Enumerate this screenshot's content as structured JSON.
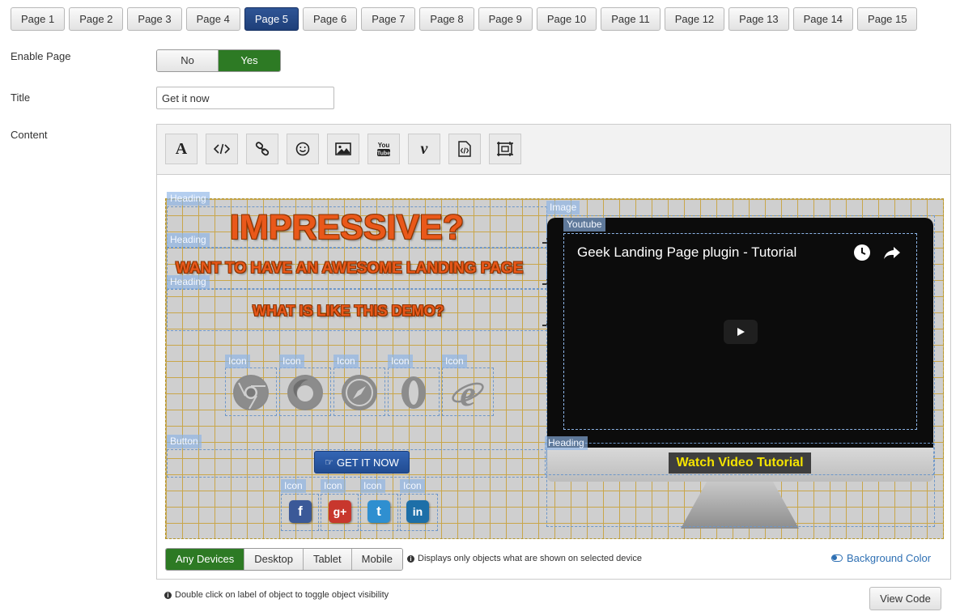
{
  "page_tabs": [
    "Page 1",
    "Page 2",
    "Page 3",
    "Page 4",
    "Page 5",
    "Page 6",
    "Page 7",
    "Page 8",
    "Page 9",
    "Page 10",
    "Page 11",
    "Page 12",
    "Page 13",
    "Page 14",
    "Page 15"
  ],
  "active_tab": "Page 5",
  "fields": {
    "enable_page_label": "Enable Page",
    "enable_no": "No",
    "enable_yes": "Yes",
    "title_label": "Title",
    "title_value": "Get it now",
    "content_label": "Content"
  },
  "toolbar_icons": [
    "text-icon",
    "code-icon",
    "link-icon",
    "smiley-icon",
    "image-icon",
    "youtube-icon",
    "vimeo-icon",
    "html-file-icon",
    "frame-icon"
  ],
  "canvas": {
    "labels": {
      "heading": "Heading",
      "image": "Image",
      "youtube": "Youtube",
      "icon": "Icon",
      "button": "Button"
    },
    "heading1": "IMPRESSIVE?",
    "heading2": "WANT TO HAVE AN AWESOME LANDING PAGE",
    "heading3": "WHAT IS LIKE THIS DEMO?",
    "browser_icons": [
      "chrome-icon",
      "firefox-icon",
      "safari-icon",
      "opera-icon",
      "ie-icon"
    ],
    "get_it_button": "GET IT NOW",
    "social_icons": [
      {
        "name": "facebook-icon",
        "glyph": "f",
        "color": "#3b5998"
      },
      {
        "name": "google-plus-icon",
        "glyph": "g+",
        "color": "#c8372d"
      },
      {
        "name": "twitter-icon",
        "glyph": "t",
        "color": "#2f8fd0"
      },
      {
        "name": "linkedin-icon",
        "glyph": "in",
        "color": "#1d6fa8"
      }
    ],
    "video_title": "Geek Landing Page plugin - Tutorial",
    "watch_label": "Watch Video Tutorial"
  },
  "devices": {
    "options": [
      "Any Devices",
      "Desktop",
      "Tablet",
      "Mobile"
    ],
    "active": "Any Devices",
    "info": "Displays only objects what are shown on selected device"
  },
  "background_color_label": "Background Color",
  "footer_hint": "Double click on label of object to toggle object visibility",
  "view_code_label": "View Code"
}
